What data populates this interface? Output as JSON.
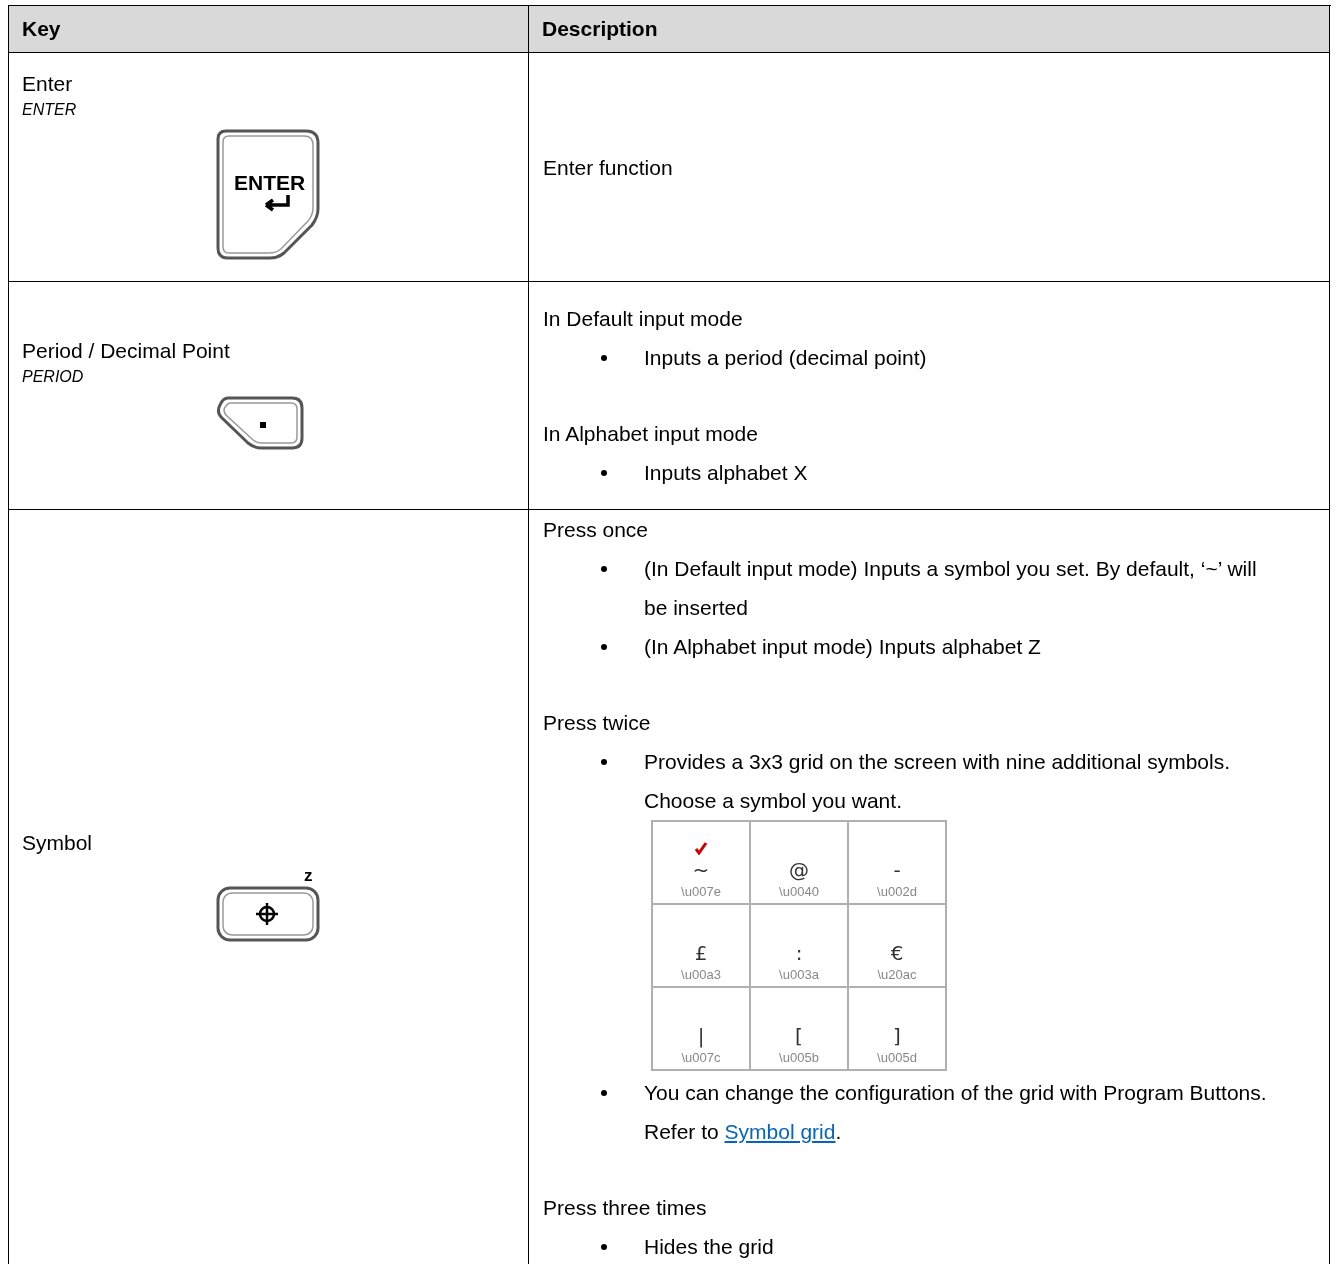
{
  "table": {
    "columns": [
      "Key",
      "Description"
    ],
    "rows": [
      {
        "key": {
          "name": "Enter",
          "code": "ENTER",
          "kind": "enter",
          "cap_label": "ENTER"
        },
        "description": [
          {
            "kind": "para",
            "text": "Enter function"
          }
        ]
      },
      {
        "key": {
          "name": "Period / Decimal Point",
          "code": "PERIOD",
          "kind": "period"
        },
        "description": [
          {
            "kind": "para",
            "text": "In Default input mode"
          },
          {
            "kind": "bullet",
            "text": "Inputs a period (decimal point)"
          },
          {
            "kind": "para",
            "text": "In Alphabet input mode"
          },
          {
            "kind": "bullet",
            "text": "Inputs alphabet X"
          }
        ]
      },
      {
        "key": {
          "name": "Symbol",
          "kind": "symbol",
          "side_label": "z"
        },
        "description": [
          {
            "kind": "para",
            "text": "Press once"
          },
          {
            "kind": "bullet",
            "text": "(In Default input mode) Inputs a symbol you set. By default, ‘~’ will be inserted"
          },
          {
            "kind": "bullet",
            "text": "(In Alphabet input mode) Inputs alphabet Z"
          },
          {
            "kind": "para",
            "text": "Press twice"
          },
          {
            "kind": "bullet",
            "text": "Provides a 3x3 grid on the screen with nine additional symbols. Choose a symbol you want."
          },
          {
            "kind": "grid",
            "cells": [
              {
                "symbol": "~",
                "code": "\\u007e",
                "selected": true
              },
              {
                "symbol": "@",
                "code": "\\u0040",
                "selected": false
              },
              {
                "symbol": "-",
                "code": "\\u002d",
                "selected": false
              },
              {
                "symbol": "£",
                "code": "\\u00a3",
                "selected": false
              },
              {
                "symbol": ":",
                "code": "\\u003a",
                "selected": false
              },
              {
                "symbol": "€",
                "code": "\\u20ac",
                "selected": false
              },
              {
                "symbol": "|",
                "code": "\\u007c",
                "selected": false
              },
              {
                "symbol": "[",
                "code": "\\u005b",
                "selected": false
              },
              {
                "symbol": "]",
                "code": "\\u005d",
                "selected": false
              }
            ]
          },
          {
            "kind": "bullet",
            "text": "You can change the configuration of the grid with Program Buttons. Refer to ",
            "link": "Symbol grid",
            "after": "."
          },
          {
            "kind": "para",
            "text": "Press three times"
          },
          {
            "kind": "bullet",
            "text": "Hides the grid"
          }
        ]
      }
    ]
  }
}
